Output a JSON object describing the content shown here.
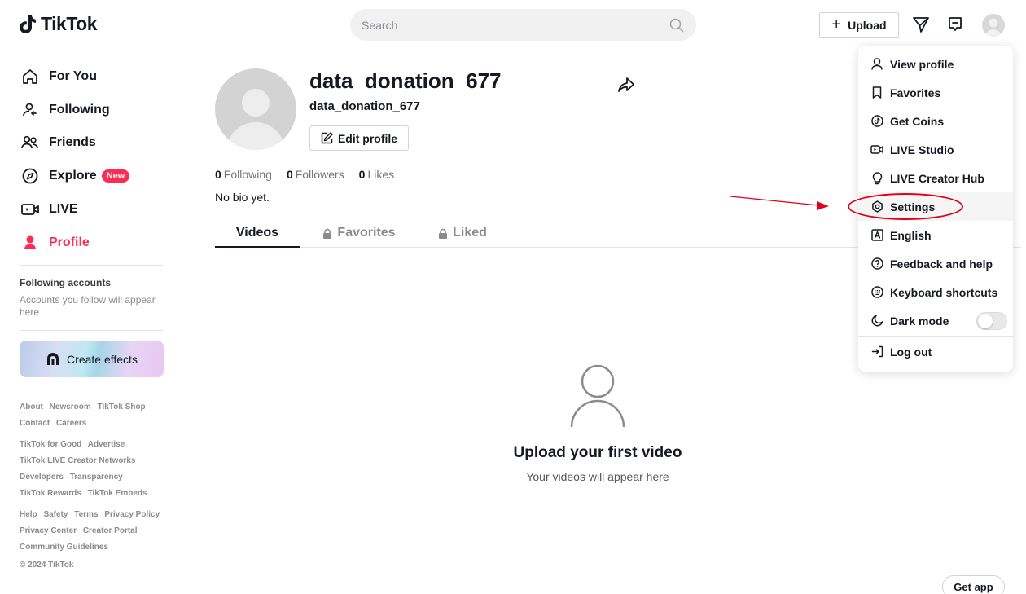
{
  "header": {
    "logo_text": "TikTok",
    "search_placeholder": "Search",
    "upload_label": "Upload"
  },
  "sidebar": {
    "nav": [
      {
        "label": "For You"
      },
      {
        "label": "Following"
      },
      {
        "label": "Friends"
      },
      {
        "label": "Explore",
        "badge": "New"
      },
      {
        "label": "LIVE"
      },
      {
        "label": "Profile"
      }
    ],
    "following_heading": "Following accounts",
    "following_sub": "Accounts you follow will appear here",
    "create_effects": "Create effects",
    "footer_groups": [
      [
        "About",
        "Newsroom",
        "TikTok Shop",
        "Contact",
        "Careers"
      ],
      [
        "TikTok for Good",
        "Advertise",
        "TikTok LIVE Creator Networks",
        "Developers",
        "Transparency",
        "TikTok Rewards",
        "TikTok Embeds"
      ],
      [
        "Help",
        "Safety",
        "Terms",
        "Privacy Policy",
        "Privacy Center",
        "Creator Portal",
        "Community Guidelines"
      ]
    ],
    "copyright": "© 2024 TikTok"
  },
  "profile": {
    "username": "data_donation_677",
    "nickname": "data_donation_677",
    "edit_label": "Edit profile",
    "stats": [
      {
        "value": "0",
        "label": "Following"
      },
      {
        "value": "0",
        "label": "Followers"
      },
      {
        "value": "0",
        "label": "Likes"
      }
    ],
    "bio": "No bio yet.",
    "tabs": [
      "Videos",
      "Favorites",
      "Liked"
    ],
    "empty_title": "Upload your first video",
    "empty_sub": "Your videos will appear here"
  },
  "menu": {
    "items": [
      {
        "label": "View profile",
        "icon": "person-icon"
      },
      {
        "label": "Favorites",
        "icon": "bookmark-icon"
      },
      {
        "label": "Get Coins",
        "icon": "coin-icon"
      },
      {
        "label": "LIVE Studio",
        "icon": "live-studio-icon"
      },
      {
        "label": "LIVE Creator Hub",
        "icon": "lightbulb-icon"
      },
      {
        "label": "Settings",
        "icon": "gear-icon"
      },
      {
        "label": "English",
        "icon": "language-icon"
      },
      {
        "label": "Feedback and help",
        "icon": "help-icon"
      },
      {
        "label": "Keyboard shortcuts",
        "icon": "keyboard-icon"
      },
      {
        "label": "Dark mode",
        "icon": "moon-icon"
      },
      {
        "label": "Log out",
        "icon": "logout-icon"
      }
    ],
    "dark_mode_on": false
  },
  "get_app": "Get app",
  "colors": {
    "brand": "#fe2c55",
    "annotation": "#e0001b"
  }
}
